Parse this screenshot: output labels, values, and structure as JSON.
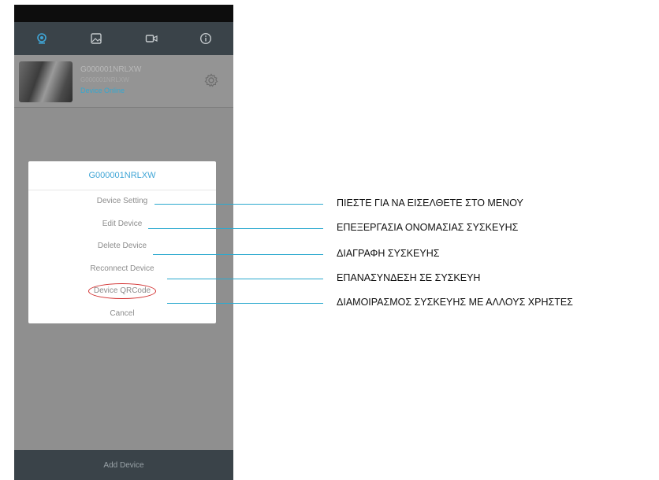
{
  "phone": {
    "tabs": [
      {
        "icon": "camera-icon",
        "active": true
      },
      {
        "icon": "gallery-icon",
        "active": false
      },
      {
        "icon": "video-icon",
        "active": false
      },
      {
        "icon": "info-icon",
        "active": false
      }
    ],
    "device": {
      "name": "G000001NRLXW",
      "id": "G000001NRLXW",
      "status": "Device Online"
    },
    "add_device_label": "Add Device"
  },
  "dialog": {
    "title": "G000001NRLXW",
    "items": [
      "Device Setting",
      "Edit Device",
      "Delete Device",
      "Reconnect Device",
      "Device QRCode",
      "Cancel"
    ]
  },
  "callouts": [
    "ΠΙΕΣΤΕ ΓΙΑ ΝΑ ΕΙΣΕΛΘΕΤΕ ΣΤΟ ΜΕΝΟΥ",
    "ΕΠΕΞΕΡΓΑΣΙΑ ΟΝΟΜΑΣΙΑΣ ΣΥΣΚΕΥΗΣ",
    "ΔΙΑΓΡΑΦΗ ΣΥΣΚΕΥΗΣ",
    "ΕΠΑΝΑΣΥΝΔΕΣΗ ΣΕ ΣΥΣΚΕΥΗ",
    "ΔΙΑΜΟΙΡΑΣΜΟΣ ΣΥΣΚΕΥΗΣ ΜΕ ΑΛΛΟΥΣ ΧΡΗΣΤΕΣ"
  ],
  "colors": {
    "accent": "#3fa5d6",
    "callout_line": "#2ba9cf",
    "highlight_circle": "#d12b2b"
  }
}
